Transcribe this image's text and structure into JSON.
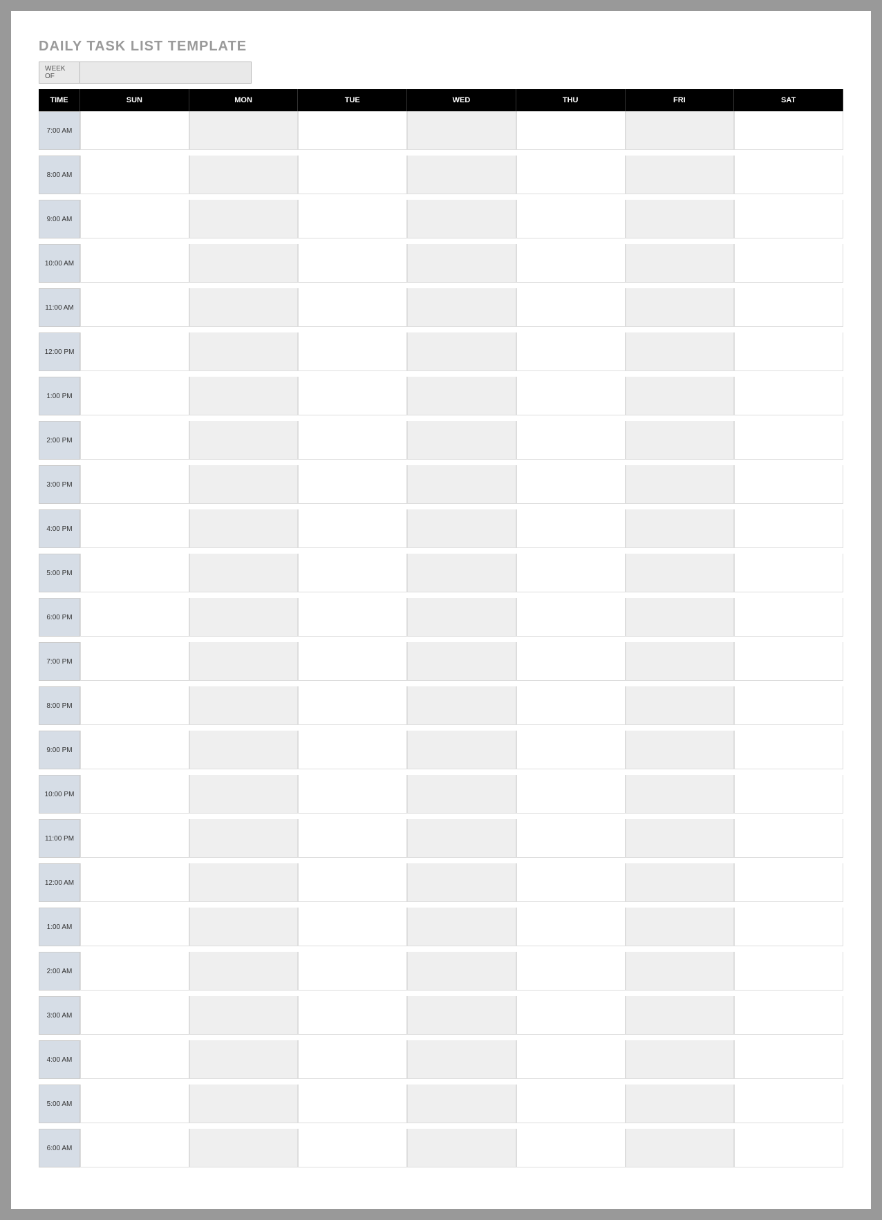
{
  "title": "DAILY TASK LIST TEMPLATE",
  "week_of_label": "WEEK OF",
  "week_of_value": "",
  "headers": {
    "time": "TIME",
    "days": [
      "SUN",
      "MON",
      "TUE",
      "WED",
      "THU",
      "FRI",
      "SAT"
    ]
  },
  "times": [
    "7:00 AM",
    "8:00 AM",
    "9:00 AM",
    "10:00 AM",
    "11:00 AM",
    "12:00 PM",
    "1:00 PM",
    "2:00 PM",
    "3:00 PM",
    "4:00 PM",
    "5:00 PM",
    "6:00 PM",
    "7:00 PM",
    "8:00 PM",
    "9:00 PM",
    "10:00 PM",
    "11:00 PM",
    "12:00 AM",
    "1:00 AM",
    "2:00 AM",
    "3:00 AM",
    "4:00 AM",
    "5:00 AM",
    "6:00 AM"
  ],
  "alt_columns": [
    false,
    true,
    false,
    true,
    false,
    true,
    false
  ]
}
